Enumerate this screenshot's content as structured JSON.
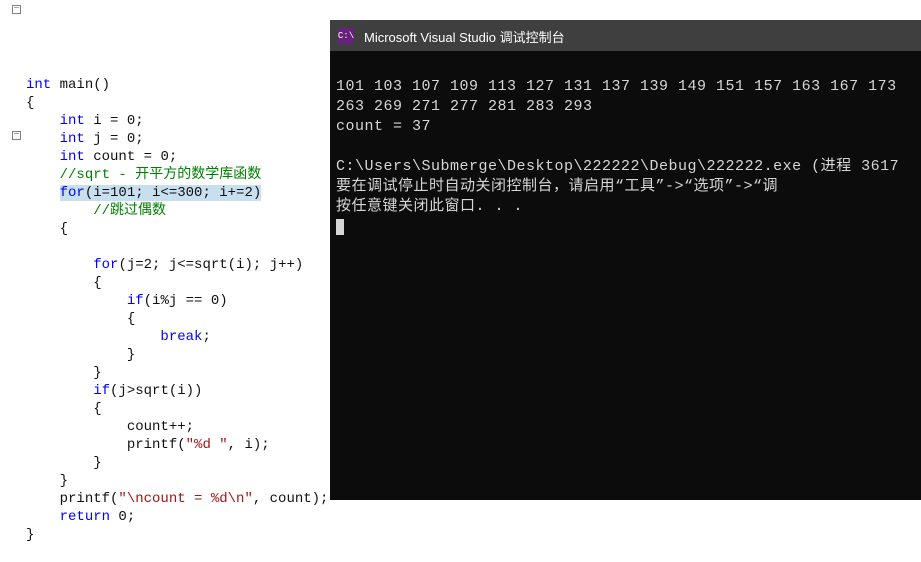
{
  "editor": {
    "lines": {
      "int_main": "int",
      "main_name": " main()",
      "brace_open": "{",
      "decl_i_kw": "int",
      "decl_i_rest": " i = 0;",
      "decl_j_kw": "int",
      "decl_j_rest": " j = 0;",
      "decl_count_kw": "int",
      "decl_count_rest": " count = 0;",
      "cmt_sqrt": "//sqrt - 开平方的数学库函数",
      "for_kw": "for",
      "for_rest": "(i=101; i<=300; i+=2)",
      "cmt_skip": "//跳过偶数",
      "brace_open2": "{",
      "for2_kw": "for",
      "for2_rest": "(j=2; j<=sqrt(i); j++)",
      "brace_open3": "{",
      "if_kw": "if",
      "if_rest": "(i%j == 0)",
      "brace_open4": "{",
      "break_kw": "break",
      "break_semi": ";",
      "brace_close4": "}",
      "brace_close3": "}",
      "if2_kw": "if",
      "if2_rest": "(j>sqrt(i))",
      "brace_open5": "{",
      "countpp": "count++;",
      "printf1_fn": "printf(",
      "printf1_str": "\"%d \"",
      "printf1_rest": ", i);",
      "brace_close5": "}",
      "brace_close2": "}",
      "printf2_fn": "printf(",
      "printf2_str": "\"\\ncount = %d\\n\"",
      "printf2_rest": ", count);",
      "return_kw": "return",
      "return_rest": " 0;",
      "brace_close": "}"
    }
  },
  "console": {
    "title": "Microsoft Visual Studio 调试控制台",
    "icon_label": "C:\\",
    "line1": "101 103 107 109 113 127 131 137 139 149 151 157 163 167 173",
    "line2": "263 269 271 277 281 283 293",
    "line3": "count = 37",
    "blank": "",
    "line4": "C:\\Users\\Submerge\\Desktop\\222222\\Debug\\222222.exe (进程 3617",
    "line5": "要在调试停止时自动关闭控制台，请启用“工具”->“选项”->“调",
    "line6": "按任意键关闭此窗口. . ."
  }
}
